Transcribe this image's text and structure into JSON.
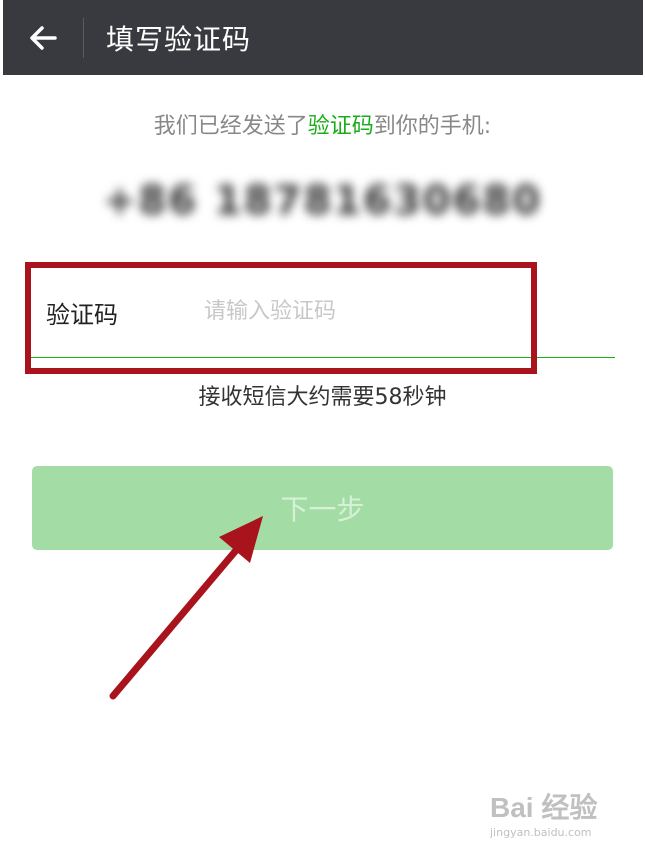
{
  "header": {
    "title": "填写验证码",
    "background": "#393a3f"
  },
  "message": {
    "prefix": "我们已经发送了",
    "highlight": "验证码",
    "suffix": "到你的手机:",
    "highlight_color": "#1aad19"
  },
  "phone": {
    "number": "+86 18781630680"
  },
  "code_field": {
    "label": "验证码",
    "placeholder": "请输入验证码",
    "value": ""
  },
  "countdown": {
    "text": "接收短信大约需要58秒钟"
  },
  "next_button": {
    "label": "下一步",
    "color": "#a3dca4"
  },
  "annotation": {
    "color": "#a8131c"
  },
  "watermark": {
    "main": "Bai 经验",
    "sub": "jingyan.baidu.com"
  }
}
